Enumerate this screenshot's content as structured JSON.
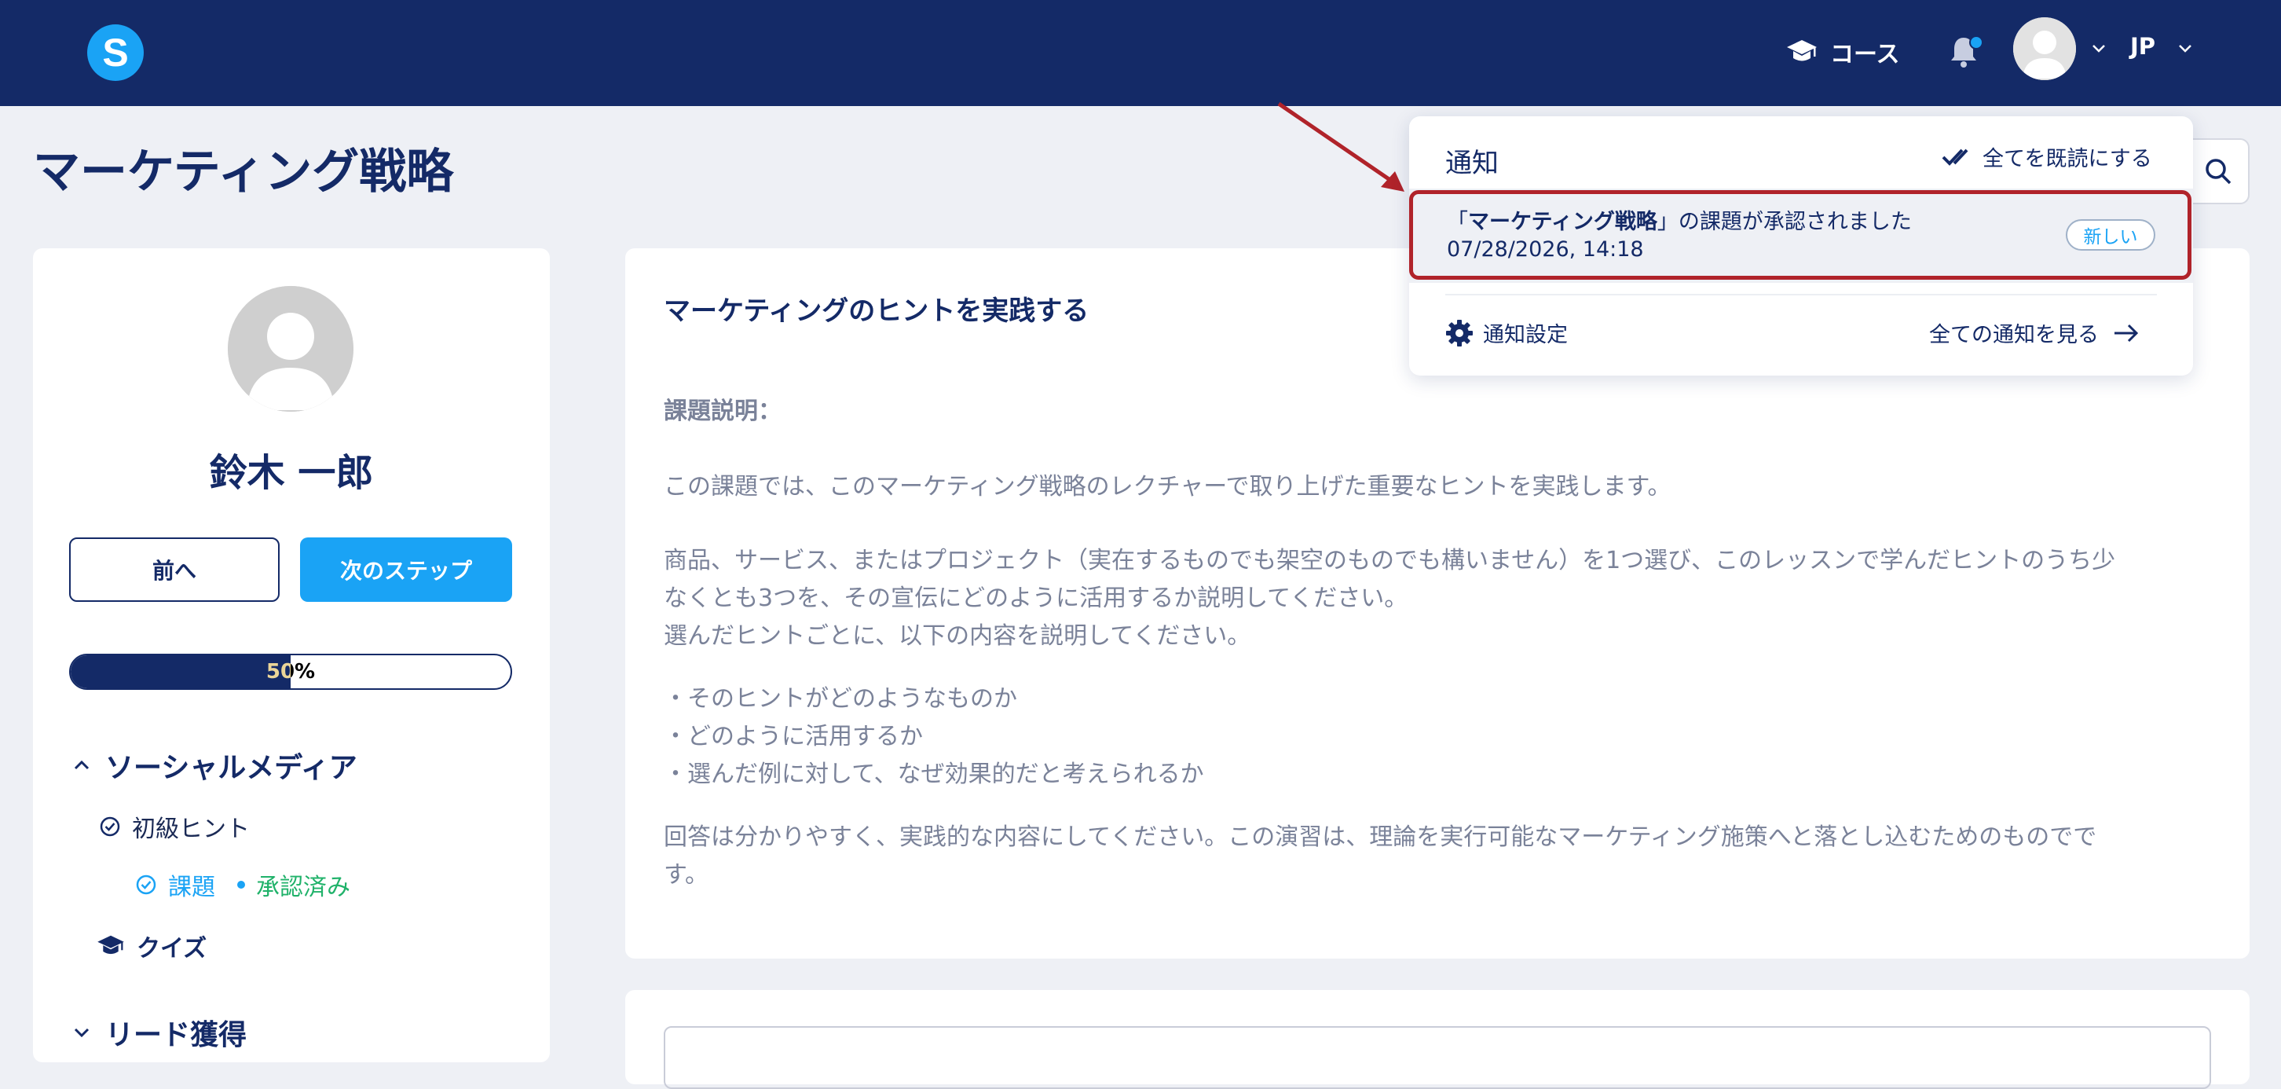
{
  "header": {
    "logo_letter": "S",
    "course_label": "コース",
    "lang_label": "JP"
  },
  "page": {
    "title": "マーケティング戦略"
  },
  "sidebar": {
    "user_name": "鈴木 一郎",
    "prev_label": "前へ",
    "next_label": "次のステップ",
    "progress_text": "50%",
    "progress_value": 0.5,
    "sections": [
      {
        "title": "ソーシャルメディア",
        "expanded": true,
        "lesson": "初級ヒント",
        "assignment": "課題",
        "assignment_status": "承認済み",
        "quiz": "クイズ"
      },
      {
        "title": "リード獲得",
        "expanded": false
      }
    ]
  },
  "main": {
    "title": "マーケティングのヒントを実践する",
    "label": "課題説明：",
    "p1": "この課題では、このマーケティング戦略のレクチャーで取り上げた重要なヒントを実践します。",
    "p2a": "商品、サービス、またはプロジェクト（実在するものでも架空のものでも構いません）を1つ選び、このレッスンで学んだヒントのうち少",
    "p2b": "なくとも3つを、その宣伝にどのように活用するか説明してください。",
    "p2c": "選んだヒントごとに、以下の内容を説明してください。",
    "bullets": [
      "・そのヒントがどのようなものか",
      "・どのように活用するか",
      "・選んだ例に対して、なぜ効果的だと考えられるか"
    ],
    "p3a": "回答は分かりやすく、実践的な内容にしてください。この演習は、理論を実行可能なマーケティング施策へと落とし込むためのものでで",
    "p3b": "す。"
  },
  "notifications": {
    "title": "通知",
    "mark_all_read": "全てを既読にする",
    "item": {
      "open_quote": "「",
      "course": "マーケティング戦略",
      "message_rest": "」の課題が承認されました",
      "time": "07/28/2026, 14:18",
      "badge": "新しい"
    },
    "settings_label": "通知設定",
    "see_all_label": "全ての通知を見る"
  },
  "colors": {
    "header_bg": "#142a67",
    "accent": "#1aa3f5",
    "approved": "#20b26a",
    "highlight": "#b0232a",
    "page_bg": "#eef0f5"
  }
}
